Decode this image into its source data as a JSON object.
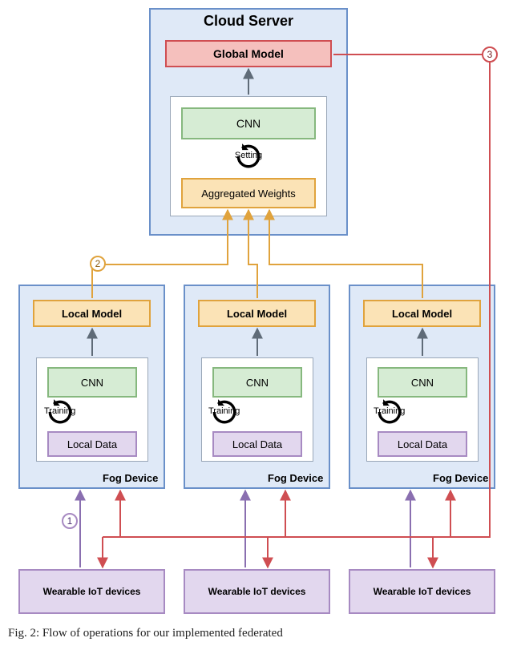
{
  "cloud": {
    "title": "Cloud Server",
    "global_model": "Global Model",
    "cnn": "CNN",
    "aggregated": "Aggregated Weights",
    "cycle_label": "Setting"
  },
  "fog": {
    "local_model": "Local Model",
    "cnn": "CNN",
    "local_data": "Local Data",
    "cycle_label": "Training",
    "label": "Fog Device"
  },
  "wearable": {
    "label": "Wearable IoT devices"
  },
  "badges": {
    "one": "1",
    "two": "2",
    "three": "3"
  },
  "caption": "Fig. 2: Flow of operations for our implemented federated",
  "icons": {
    "refresh": "refresh-icon"
  },
  "colors": {
    "cloud_border": "#6a90c9",
    "cloud_fill": "#dfe9f7",
    "global_border": "#cf4e52",
    "global_fill": "#f5c0bd",
    "cnn_border": "#86b87e",
    "cnn_fill": "#d6ecd4",
    "agg_border": "#e0a33d",
    "agg_fill": "#fbe3b6",
    "data_border": "#a78ac2",
    "data_fill": "#e2d7ee",
    "arrow_gray": "#5f6b78",
    "arrow_purple": "#8a6fb0",
    "arrow_orange": "#e0a33d",
    "arrow_red": "#cf4e52"
  }
}
